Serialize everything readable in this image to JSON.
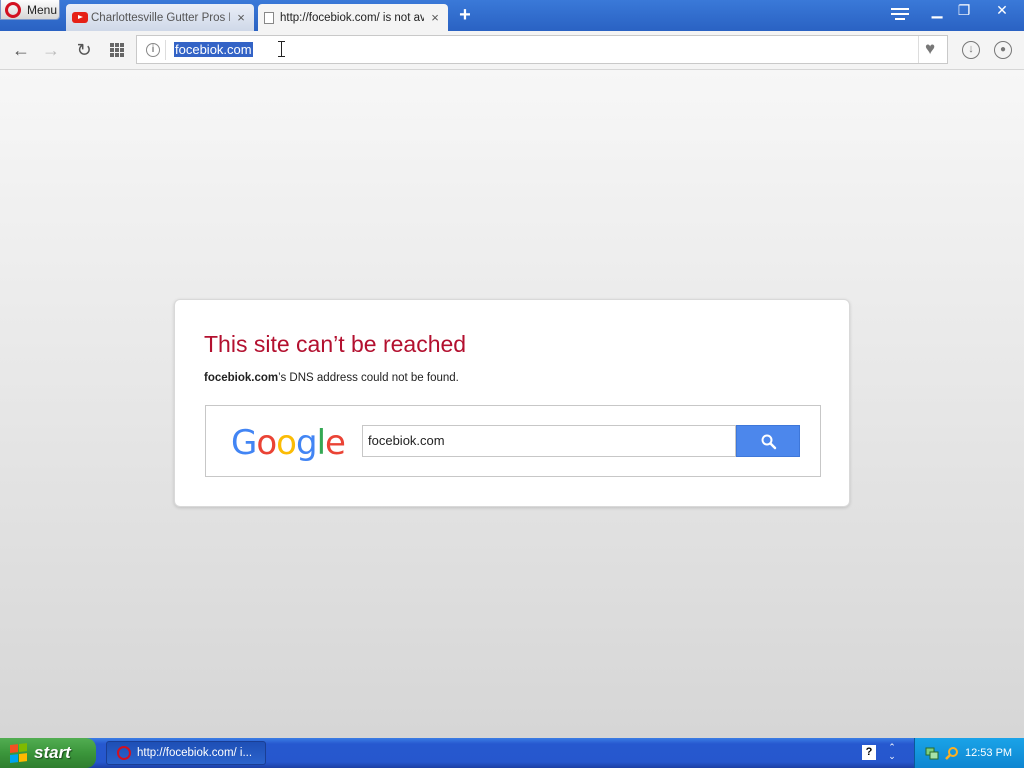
{
  "browser": {
    "menu_label": "Menu",
    "tabs": [
      {
        "title": "Charlottesville Gutter Pros R",
        "close": "×",
        "active": false
      },
      {
        "title": "http://focebiok.com/ is not av",
        "close": "×",
        "active": true
      }
    ],
    "new_tab": "+",
    "window_controls": {
      "minimize": "▁",
      "maximize": "❐",
      "close": "✕"
    },
    "nav": {
      "back": "←",
      "forward": "→",
      "reload": "↻"
    },
    "address": {
      "url": "focebiok.com",
      "info_glyph": "i"
    },
    "toolbar_icons": [
      "heart-icon",
      "download-icon",
      "account-icon"
    ]
  },
  "error_page": {
    "title": "This site can’t be reached",
    "domain": "focebiok.com",
    "description_suffix": "’s DNS address could not be found.",
    "search_query": "focebiok.com",
    "google_letters": [
      {
        "char": "G",
        "color": "#4285f4"
      },
      {
        "char": "o",
        "color": "#ea4335"
      },
      {
        "char": "o",
        "color": "#fbbc05"
      },
      {
        "char": "g",
        "color": "#4285f4"
      },
      {
        "char": "l",
        "color": "#34a853"
      },
      {
        "char": "e",
        "color": "#ea4335"
      }
    ]
  },
  "taskbar": {
    "start_label": "start",
    "task_item": "http://focebiok.com/ i...",
    "help_glyph": "?",
    "clock": "12:53 PM"
  },
  "colors": {
    "error_title": "#b3102f",
    "search_button": "#4c87ec",
    "titlebar": "#2a62c3",
    "opera_red": "#d31020"
  }
}
